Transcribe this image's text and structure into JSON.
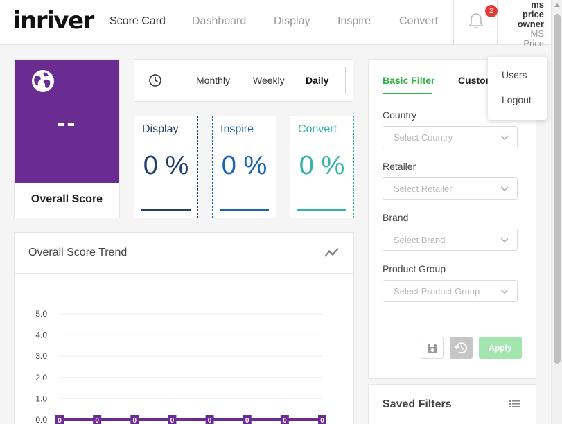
{
  "header": {
    "logo": "inriver",
    "nav": [
      "Score Card",
      "Dashboard",
      "Display",
      "Inspire",
      "Convert"
    ],
    "notification_count": "2",
    "user": {
      "name_lines": [
        "ms",
        "price",
        "owner"
      ],
      "sub_lines": [
        "MS",
        "Price"
      ]
    }
  },
  "overall": {
    "value": "--",
    "label": "Overall Score",
    "color": "#6a2c91"
  },
  "period": {
    "options": [
      "Monthly",
      "Weekly",
      "Daily"
    ],
    "selected": "Daily"
  },
  "metrics": [
    {
      "title": "Display",
      "value": "0 %",
      "color": "#1f3d6e"
    },
    {
      "title": "Inspire",
      "value": "0 %",
      "color": "#1e64b4"
    },
    {
      "title": "Convert",
      "value": "0 %",
      "color": "#35b3a8"
    }
  ],
  "trend": {
    "title": "Overall Score Trend",
    "chart_data": {
      "type": "line",
      "y_ticks": [
        "5.0",
        "4.0",
        "3.0",
        "2.0",
        "1.0",
        "0.0"
      ],
      "ylim": [
        0,
        5
      ],
      "series": [
        {
          "values": [
            0,
            0,
            0,
            0,
            0,
            0,
            0,
            0
          ],
          "labels": [
            "0",
            "0",
            "0",
            "0",
            "0",
            "0",
            "0",
            "0"
          ],
          "color": "#6a2c91"
        }
      ]
    }
  },
  "filter": {
    "tabs": [
      "Basic Filter",
      "Custom"
    ],
    "fields": [
      {
        "label": "Country",
        "placeholder": "Select Country"
      },
      {
        "label": "Retailer",
        "placeholder": "Select Retailer"
      },
      {
        "label": "Brand",
        "placeholder": "Select Brand"
      },
      {
        "label": "Product Group",
        "placeholder": "Select Product Group"
      }
    ],
    "apply_label": "Apply"
  },
  "saved_filters": {
    "title": "Saved Filters"
  },
  "user_menu": [
    "Users",
    "Logout"
  ]
}
